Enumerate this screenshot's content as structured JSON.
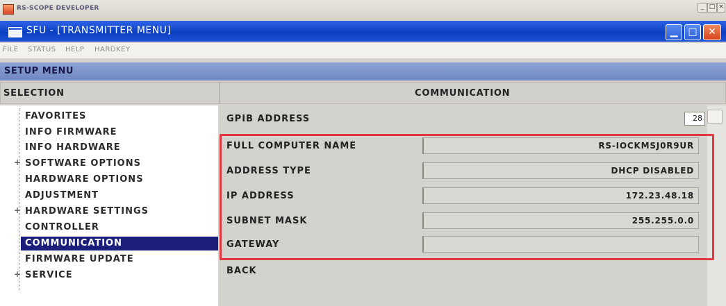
{
  "outer_window": {
    "title": "RS-SCOPE DEVELOPER"
  },
  "window": {
    "title": "SFU - [TRANSMITTER MENU]"
  },
  "menubar": {
    "items": [
      "FILE",
      "STATUS",
      "HELP",
      "HARDKEY"
    ]
  },
  "setup_menu": {
    "label": "SETUP MENU"
  },
  "selection": {
    "header": "SELECTION",
    "items": [
      {
        "label": "FAVORITES"
      },
      {
        "label": "INFO FIRMWARE"
      },
      {
        "label": "INFO HARDWARE"
      },
      {
        "label": "SOFTWARE OPTIONS",
        "expander": "+"
      },
      {
        "label": "HARDWARE OPTIONS"
      },
      {
        "label": "ADJUSTMENT"
      },
      {
        "label": "HARDWARE SETTINGS",
        "expander": "+"
      },
      {
        "label": "CONTROLLER"
      },
      {
        "label": "COMMUNICATION",
        "selected": true
      },
      {
        "label": "FIRMWARE UPDATE"
      },
      {
        "label": "SERVICE",
        "expander": "+"
      }
    ]
  },
  "communication": {
    "header": "COMMUNICATION",
    "gpib_label": "GPIB ADDRESS",
    "gpib_value": "28",
    "fields": [
      {
        "label": "FULL COMPUTER NAME",
        "value": "RS-IOCKMSJ0R9UR"
      },
      {
        "label": "ADDRESS TYPE",
        "value": "DHCP DISABLED"
      },
      {
        "label": "IP ADDRESS",
        "value": "172.23.48.18"
      },
      {
        "label": "SUBNET MASK",
        "value": "255.255.0.0"
      },
      {
        "label": "GATEWAY",
        "value": ""
      }
    ],
    "back_label": "BACK"
  },
  "colors": {
    "selection_bg": "#1b1f7a",
    "highlight_box": "#e0383e",
    "titlebar": "#0a3fc2"
  }
}
